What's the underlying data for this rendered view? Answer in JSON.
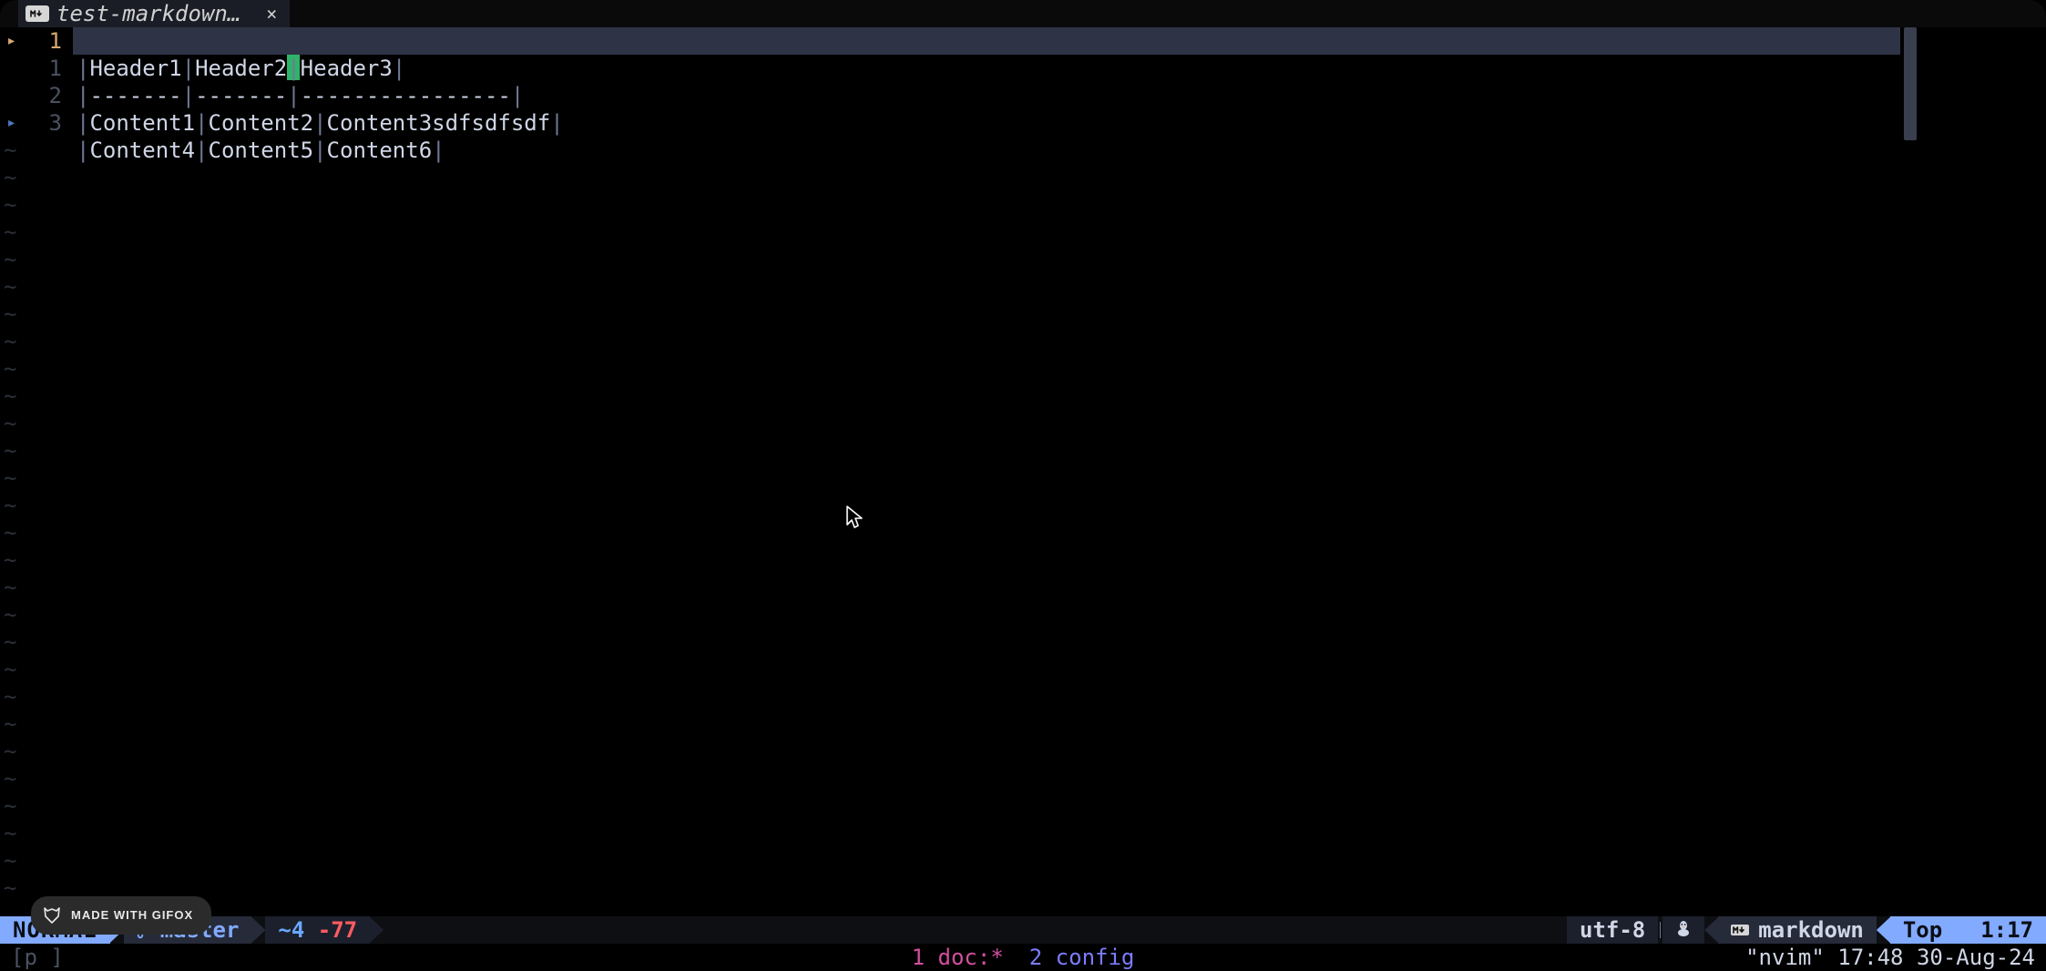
{
  "tab": {
    "filetype_badge": "M↓",
    "title": "test-markdown…",
    "close_glyph": "×"
  },
  "gutter": {
    "current_line_abs": "1",
    "relnums": [
      "1",
      "2",
      "3"
    ],
    "tilde": "~"
  },
  "buffer": {
    "line1": {
      "c1": "Header1",
      "c2": "Header2",
      "c3": "Header3"
    },
    "line2": {
      "c1": "-------",
      "c2": "-------",
      "c3": "----------------"
    },
    "line3": {
      "c1": "Content1",
      "c2": "Content2",
      "c3": "Content3sdfsdfsdf"
    },
    "line4": {
      "c1": "Content4",
      "c2": "Content5",
      "c3": "Content6"
    }
  },
  "statusline": {
    "mode": "NORMAL",
    "branch": "master",
    "diff_added": "~4",
    "diff_removed": "-77",
    "encoding": "utf-8",
    "os_icon": "linux",
    "filetype_badge": "M↓",
    "filetype": "markdown",
    "position": "Top",
    "location": "1:17"
  },
  "cmdline": {
    "left_text": "[p    ]",
    "tabs": [
      {
        "n": "1",
        "label": "doc:*"
      },
      {
        "n": "2",
        "label": "config"
      }
    ],
    "right_text": "\"nvim\" 17:48 30-Aug-24"
  },
  "watermark": {
    "text": "MADE WITH GIFOX"
  }
}
